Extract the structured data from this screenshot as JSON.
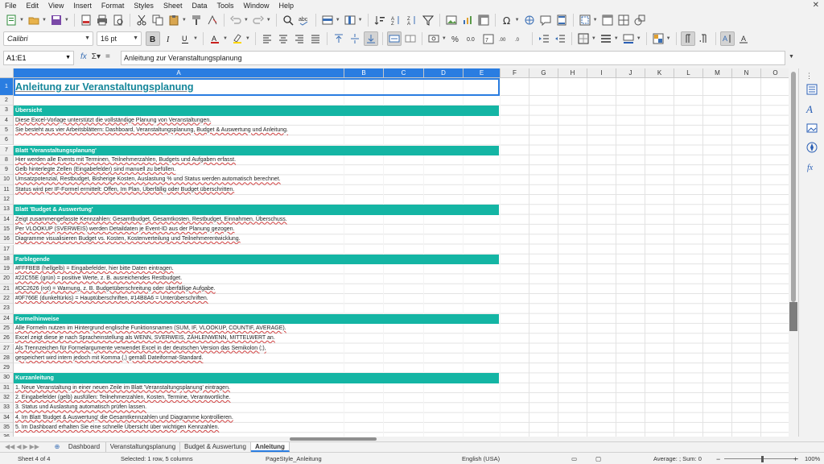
{
  "menu": [
    "File",
    "Edit",
    "View",
    "Insert",
    "Format",
    "Styles",
    "Sheet",
    "Data",
    "Tools",
    "Window",
    "Help"
  ],
  "font": {
    "name": "Calibri",
    "size": "16 pt"
  },
  "formula_bar": {
    "cell_ref": "A1:E1",
    "formula": "Anleitung zur Veranstaltungsplanung"
  },
  "columns": [
    "A",
    "B",
    "C",
    "D",
    "E",
    "F",
    "G",
    "H",
    "I",
    "J",
    "K",
    "L",
    "M",
    "N",
    "O"
  ],
  "rows": [
    {
      "n": "1",
      "kind": "title",
      "text": "Anleitung zur Veranstaltungsplanung"
    },
    {
      "n": "2",
      "kind": "empty",
      "text": ""
    },
    {
      "n": "3",
      "kind": "header",
      "text": "Übersicht"
    },
    {
      "n": "4",
      "kind": "text",
      "text": "Diese Excel-Vorlage unterstützt die vollständige Planung von Veranstaltungen."
    },
    {
      "n": "5",
      "kind": "text",
      "text": "Sie besteht aus vier Arbeitsblättern: Dashboard, Veranstaltungsplanung, Budget & Auswertung und Anleitung."
    },
    {
      "n": "6",
      "kind": "empty",
      "text": ""
    },
    {
      "n": "7",
      "kind": "header",
      "text": "Blatt 'Veranstaltungsplanung'"
    },
    {
      "n": "8",
      "kind": "text",
      "text": "Hier werden alle Events mit Terminen, Teilnehmerzahlen, Budgets und Aufgaben erfasst."
    },
    {
      "n": "9",
      "kind": "text",
      "text": "Gelb hinterlegte Zellen (Eingabefelder) sind manuell zu befüllen."
    },
    {
      "n": "10",
      "kind": "text",
      "text": "Umsatzpotenzial, Restbudget, Bisherige Kosten, Auslastung % und Status werden automatisch berechnet."
    },
    {
      "n": "11",
      "kind": "text",
      "text": "Status wird per IF-Formel ermittelt: Offen, Im Plan, Überfällig oder Budget überschritten."
    },
    {
      "n": "12",
      "kind": "empty",
      "text": ""
    },
    {
      "n": "13",
      "kind": "header",
      "text": "Blatt 'Budget & Auswertung'"
    },
    {
      "n": "14",
      "kind": "text",
      "text": "Zeigt zusammengefasste Kennzahlen: Gesamtbudget, Gesamtkosten, Restbudget, Einnahmen, Überschuss."
    },
    {
      "n": "15",
      "kind": "text",
      "text": "Per VLOOKUP (SVERWEIS) werden Detaildaten je Event-ID aus der Planung gezogen."
    },
    {
      "n": "16",
      "kind": "text",
      "text": "Diagramme visualisieren Budget vs. Kosten, Kostenverteilung und Teilnehmerentwicklung."
    },
    {
      "n": "17",
      "kind": "empty",
      "text": ""
    },
    {
      "n": "18",
      "kind": "header",
      "text": "Farblegende"
    },
    {
      "n": "19",
      "kind": "text",
      "text": "#FFFBEB (hellgelb) = Eingabefelder, hier bitte Daten eintragen."
    },
    {
      "n": "20",
      "kind": "text",
      "text": "#22C55E (grün) = positive Werte, z. B. ausreichendes Restbudget."
    },
    {
      "n": "21",
      "kind": "text",
      "text": "#DC2626 (rot) = Warnung, z. B. Budgetüberschreitung oder überfällige Aufgabe."
    },
    {
      "n": "22",
      "kind": "text",
      "text": "#0F766E (dunkeltürkis) = Hauptüberschriften, #14B8A6 = Unterüberschriften."
    },
    {
      "n": "23",
      "kind": "empty",
      "text": ""
    },
    {
      "n": "24",
      "kind": "header",
      "text": "Formelhinweise"
    },
    {
      "n": "25",
      "kind": "text",
      "text": "Alle Formeln nutzen im Hintergrund englische Funktionsnamen (SUM, IF, VLOOKUP, COUNTIF, AVERAGE)."
    },
    {
      "n": "26",
      "kind": "text",
      "text": "Excel zeigt diese je nach Spracheinstellung als WENN, SVERWEIS, ZÄHLENWENN, MITTELWERT an."
    },
    {
      "n": "27",
      "kind": "text",
      "text": "Als Trennzeichen für Formelargumente verwendet Excel in der deutschen Version das Semikolon (;),"
    },
    {
      "n": "28",
      "kind": "text",
      "text": "gespeichert wird intern jedoch mit Komma (,) gemäß Dateiformat-Standard."
    },
    {
      "n": "29",
      "kind": "empty",
      "text": ""
    },
    {
      "n": "30",
      "kind": "header",
      "text": "Kurzanleitung"
    },
    {
      "n": "31",
      "kind": "text",
      "text": "1. Neue Veranstaltung in einer neuen Zeile im Blatt 'Veranstaltungsplanung' eintragen."
    },
    {
      "n": "32",
      "kind": "text",
      "text": "2. Eingabefelder (gelb) ausfüllen: Teilnehmerzahlen, Kosten, Termine, Verantwortliche."
    },
    {
      "n": "33",
      "kind": "text",
      "text": "3. Status und Auslastung automatisch prüfen lassen."
    },
    {
      "n": "34",
      "kind": "text",
      "text": "4. Im Blatt 'Budget & Auswertung' die Gesamtkennzahlen und Diagramme kontrollieren."
    },
    {
      "n": "35",
      "kind": "text",
      "text": "5. Im Dashboard erhalten Sie eine schnelle Übersicht über wichtigen Kennzahlen."
    },
    {
      "n": "36",
      "kind": "empty",
      "text": ""
    }
  ],
  "sheet_tabs": [
    "Dashboard",
    "Veranstaltungsplanung",
    "Budget & Auswertung",
    "Anleitung"
  ],
  "active_tab": "Anleitung",
  "status_bar": {
    "sheet": "Sheet 4 of 4",
    "selection": "Selected: 1 row, 5 columns",
    "page_style": "PageStyle_Anleitung",
    "language": "English (USA)",
    "summary": "Average: ; Sum: 0",
    "zoom": "100%"
  },
  "colors": {
    "header_fill": "#14b5a4",
    "title_text": "#14869a",
    "selection": "#2a7de1"
  }
}
